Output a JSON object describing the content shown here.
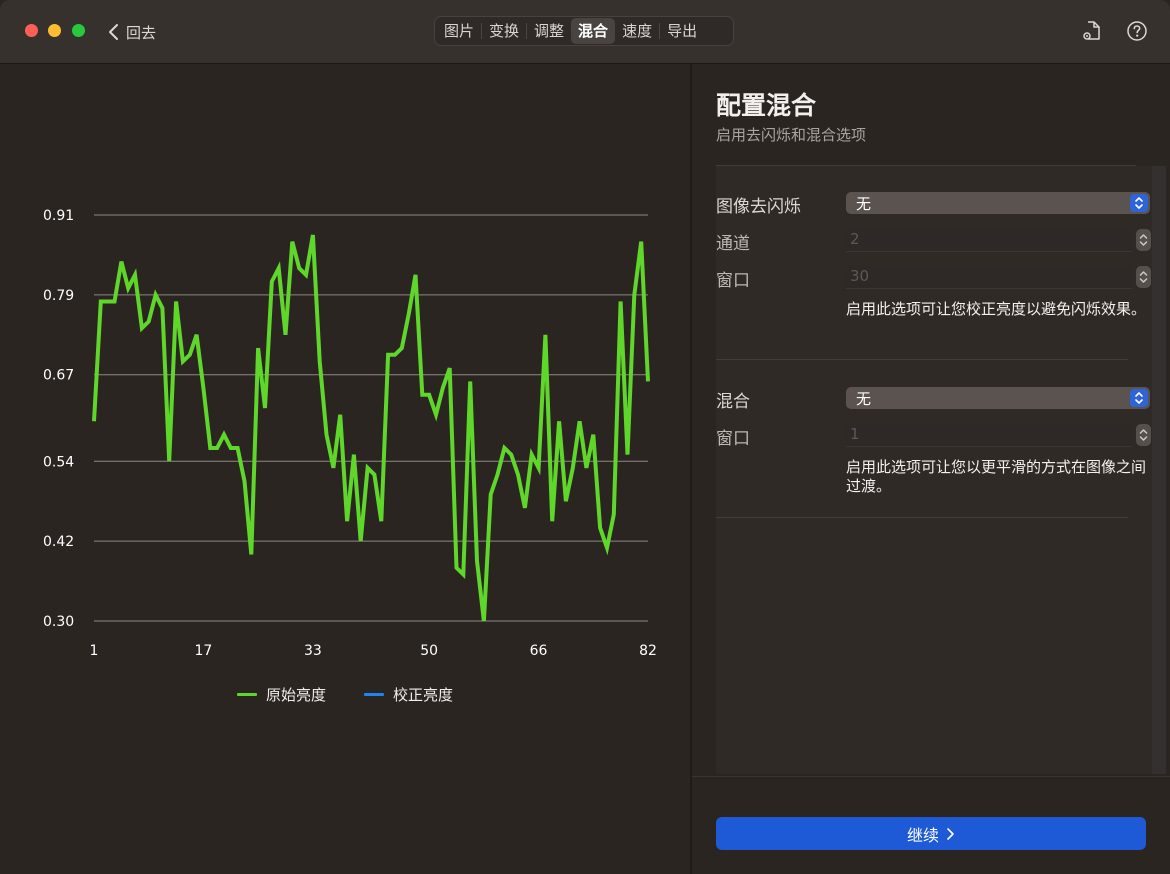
{
  "titlebar": {
    "back_label": "回去",
    "tabs": [
      {
        "label": "图片",
        "active": false
      },
      {
        "label": "变换",
        "active": false
      },
      {
        "label": "调整",
        "active": false
      },
      {
        "label": "混合",
        "active": true
      },
      {
        "label": "速度",
        "active": false
      },
      {
        "label": "导出",
        "active": false
      }
    ],
    "icons": [
      "document-gear-icon",
      "help-icon"
    ]
  },
  "chart_data": {
    "type": "line",
    "title": "",
    "xlabel": "",
    "ylabel": "",
    "ylim": [
      0.3,
      0.91
    ],
    "yticks": [
      "0.91",
      "0.79",
      "0.67",
      "0.54",
      "0.42",
      "0.30"
    ],
    "xlim": [
      1,
      82
    ],
    "xticks": [
      "1",
      "17",
      "33",
      "50",
      "66",
      "82"
    ],
    "grid": "horizontal",
    "legend_position": "bottom",
    "series": [
      {
        "name": "原始亮度",
        "color": "#5ed62a",
        "y": [
          0.6,
          0.78,
          0.78,
          0.78,
          0.84,
          0.8,
          0.82,
          0.74,
          0.75,
          0.79,
          0.77,
          0.54,
          0.78,
          0.69,
          0.7,
          0.73,
          0.65,
          0.56,
          0.56,
          0.58,
          0.56,
          0.56,
          0.51,
          0.4,
          0.71,
          0.62,
          0.81,
          0.83,
          0.73,
          0.87,
          0.83,
          0.82,
          0.88,
          0.69,
          0.58,
          0.53,
          0.61,
          0.45,
          0.55,
          0.42,
          0.53,
          0.52,
          0.45,
          0.7,
          0.7,
          0.71,
          0.76,
          0.82,
          0.64,
          0.64,
          0.61,
          0.65,
          0.68,
          0.38,
          0.37,
          0.66,
          0.39,
          0.3,
          0.49,
          0.52,
          0.56,
          0.55,
          0.52,
          0.47,
          0.55,
          0.53,
          0.73,
          0.45,
          0.6,
          0.48,
          0.53,
          0.6,
          0.53,
          0.58,
          0.44,
          0.41,
          0.46,
          0.78,
          0.55,
          0.79,
          0.87,
          0.66
        ]
      },
      {
        "name": "校正亮度",
        "color": "#1e84f5",
        "y": []
      }
    ]
  },
  "panel": {
    "title": "配置混合",
    "subtitle": "启用去闪烁和混合选项",
    "deflicker": {
      "label": "图像去闪烁",
      "value": "无",
      "channel_label": "通道",
      "channel_value": "2",
      "window_label": "窗口",
      "window_value": "30",
      "help": "启用此选项可让您校正亮度以避免闪烁效果。"
    },
    "blend": {
      "label": "混合",
      "value": "无",
      "window_label": "窗口",
      "window_value": "1",
      "help": "启用此选项可让您以更平滑的方式在图像之间过渡。"
    },
    "continue_label": "继续"
  },
  "colors": {
    "accent": "#1e5ad6",
    "background": "#2b2522"
  }
}
